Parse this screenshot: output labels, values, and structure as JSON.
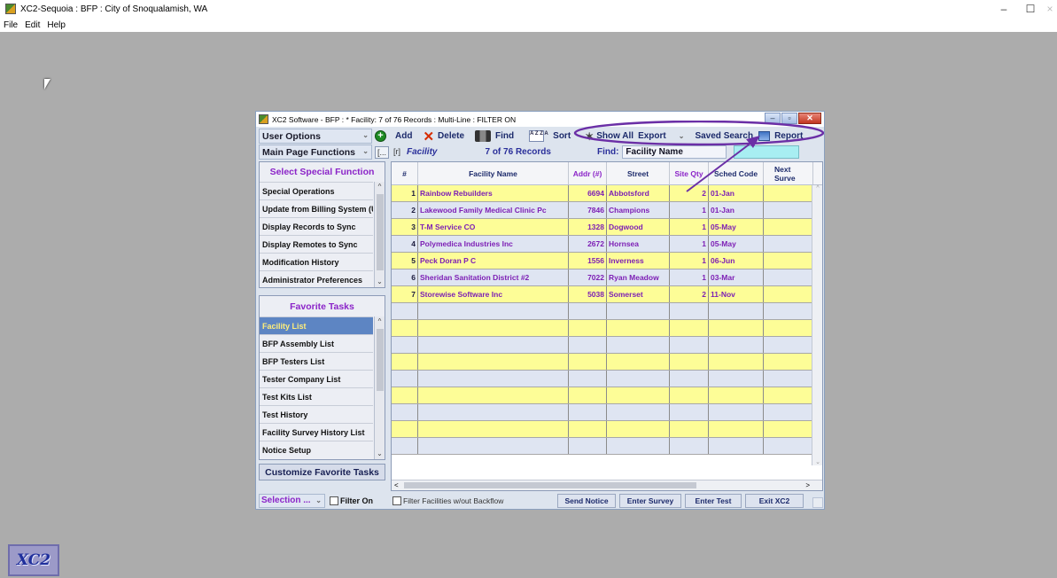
{
  "app": {
    "title": "XC2-Sequoia : BFP : City of Snoqualamish, WA",
    "menu": [
      "File",
      "Edit",
      "Help"
    ],
    "minimize": "–",
    "maximize": "☐",
    "close": "×",
    "tray_logo": "XC2"
  },
  "window": {
    "title": "XC2 Software - BFP : * Facility: 7 of 76 Records : Multi-Line : FILTER ON"
  },
  "toolbar": {
    "user_options": "User Options",
    "add": "Add",
    "delete": "Delete",
    "find": "Find",
    "sort": "Sort",
    "show_all": "Show All",
    "export": "Export",
    "saved_search": "Saved Search",
    "report": "Report",
    "main_page_functions": "Main Page Functions",
    "bracket_btn": "[...",
    "r_btn": "[r]",
    "facility_label": "Facility",
    "record_count": "7 of 76 Records",
    "find_label": "Find:",
    "find_field": "Facility Name",
    "sort_icon_text": "A Z Z A"
  },
  "special_functions": {
    "title": "Select Special Function",
    "items": [
      "Special Operations",
      "Update from Billing System (UF",
      "Display Records to Sync",
      "Display Remotes to Sync",
      "Modification History",
      "Administrator Preferences"
    ]
  },
  "favorite_tasks": {
    "title": "Favorite Tasks",
    "items": [
      "Facility List",
      "BFP Assembly List",
      "BFP Testers List",
      "Tester Company List",
      "Test Kits List",
      "Test History",
      "Facility Survey History List",
      "Notice Setup"
    ],
    "selected": "Facility List",
    "customize": "Customize Favorite Tasks"
  },
  "grid": {
    "columns": [
      "#",
      "Facility Name",
      "Addr (#)",
      "Street",
      "Site Qty",
      "Sched Code",
      "Next Surve"
    ],
    "rows": [
      {
        "num": "1",
        "name": "Rainbow Rebuilders",
        "addr": "6694",
        "street": "Abbotsford",
        "qty": "2",
        "sched": "01-Jan",
        "next": ""
      },
      {
        "num": "2",
        "name": "Lakewood Family Medical Clinic Pc",
        "addr": "7846",
        "street": "Champions",
        "qty": "1",
        "sched": "01-Jan",
        "next": ""
      },
      {
        "num": "3",
        "name": "T-M Service CO",
        "addr": "1328",
        "street": "Dogwood",
        "qty": "1",
        "sched": "05-May",
        "next": ""
      },
      {
        "num": "4",
        "name": "Polymedica Industries Inc",
        "addr": "2672",
        "street": "Hornsea",
        "qty": "1",
        "sched": "05-May",
        "next": ""
      },
      {
        "num": "5",
        "name": "Peck Doran P C",
        "addr": "1556",
        "street": "Inverness",
        "qty": "1",
        "sched": "06-Jun",
        "next": ""
      },
      {
        "num": "6",
        "name": "Sheridan Sanitation District #2",
        "addr": "7022",
        "street": "Ryan Meadow",
        "qty": "1",
        "sched": "03-Mar",
        "next": ""
      },
      {
        "num": "7",
        "name": "Storewise Software Inc",
        "addr": "5038",
        "street": "Somerset",
        "qty": "2",
        "sched": "11-Nov",
        "next": ""
      }
    ]
  },
  "bottom": {
    "selection": "Selection ...",
    "filter_on": "Filter On",
    "filter_backflow": "Filter Facilities w/out Backflow",
    "send_notice": "Send Notice",
    "enter_survey": "Enter Survey",
    "enter_test": "Enter Test",
    "exit": "Exit XC2"
  },
  "colors": {
    "row_yellow": "#fdfd97",
    "row_blue": "#dfe5f2",
    "accent_purple": "#8b24c8",
    "selected_item": "#5d85c3",
    "annotation": "#6b2fa6"
  }
}
